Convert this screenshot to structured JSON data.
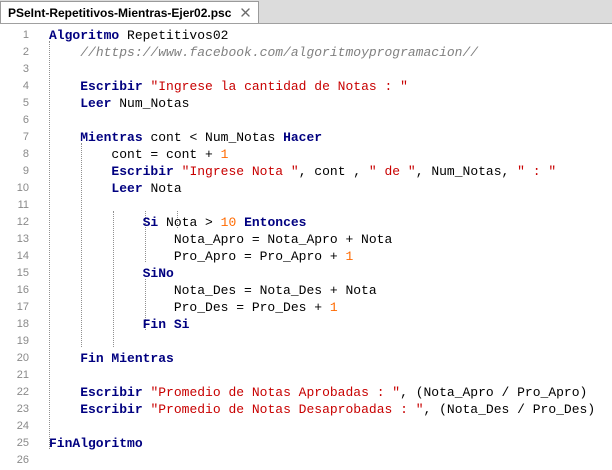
{
  "tab": {
    "title": "PSeInt-Repetitivos-Mientras-Ejer02.psc",
    "close_icon": "close-icon"
  },
  "colors": {
    "keyword": "#000080",
    "string": "#c80000",
    "comment": "#808080",
    "number": "#ff6a00",
    "line_number": "#8a8a8a"
  },
  "lines": [
    {
      "n": "1",
      "tokens": [
        {
          "t": "kw",
          "v": "Algoritmo"
        },
        {
          "t": "txt",
          "v": " Repetitivos02"
        }
      ]
    },
    {
      "n": "2",
      "tokens": [
        {
          "t": "txt",
          "v": "    "
        },
        {
          "t": "cmt",
          "v": "//https://www.facebook.com/algoritmoyprogramacion//"
        }
      ]
    },
    {
      "n": "3",
      "tokens": []
    },
    {
      "n": "4",
      "tokens": [
        {
          "t": "txt",
          "v": "    "
        },
        {
          "t": "kw",
          "v": "Escribir"
        },
        {
          "t": "txt",
          "v": " "
        },
        {
          "t": "str",
          "v": "\"Ingrese la cantidad de Notas : \""
        }
      ]
    },
    {
      "n": "5",
      "tokens": [
        {
          "t": "txt",
          "v": "    "
        },
        {
          "t": "kw",
          "v": "Leer"
        },
        {
          "t": "txt",
          "v": " Num_Notas"
        }
      ]
    },
    {
      "n": "6",
      "tokens": []
    },
    {
      "n": "7",
      "tokens": [
        {
          "t": "txt",
          "v": "    "
        },
        {
          "t": "kw",
          "v": "Mientras"
        },
        {
          "t": "txt",
          "v": " cont < Num_Notas "
        },
        {
          "t": "kw",
          "v": "Hacer"
        }
      ]
    },
    {
      "n": "8",
      "tokens": [
        {
          "t": "txt",
          "v": "        cont = cont + "
        },
        {
          "t": "num",
          "v": "1"
        }
      ]
    },
    {
      "n": "9",
      "tokens": [
        {
          "t": "txt",
          "v": "        "
        },
        {
          "t": "kw",
          "v": "Escribir"
        },
        {
          "t": "txt",
          "v": " "
        },
        {
          "t": "str",
          "v": "\"Ingrese Nota \""
        },
        {
          "t": "txt",
          "v": ", cont , "
        },
        {
          "t": "str",
          "v": "\" de \""
        },
        {
          "t": "txt",
          "v": ", Num_Notas, "
        },
        {
          "t": "str",
          "v": "\" : \""
        }
      ]
    },
    {
      "n": "10",
      "tokens": [
        {
          "t": "txt",
          "v": "        "
        },
        {
          "t": "kw",
          "v": "Leer"
        },
        {
          "t": "txt",
          "v": " Nota"
        }
      ]
    },
    {
      "n": "11",
      "tokens": []
    },
    {
      "n": "12",
      "tokens": [
        {
          "t": "txt",
          "v": "            "
        },
        {
          "t": "kw",
          "v": "Si"
        },
        {
          "t": "txt",
          "v": " Nota > "
        },
        {
          "t": "num",
          "v": "10"
        },
        {
          "t": "txt",
          "v": " "
        },
        {
          "t": "kw",
          "v": "Entonces"
        }
      ]
    },
    {
      "n": "13",
      "tokens": [
        {
          "t": "txt",
          "v": "                Nota_Apro = Nota_Apro + Nota"
        }
      ]
    },
    {
      "n": "14",
      "tokens": [
        {
          "t": "txt",
          "v": "                Pro_Apro = Pro_Apro + "
        },
        {
          "t": "num",
          "v": "1"
        }
      ]
    },
    {
      "n": "15",
      "tokens": [
        {
          "t": "txt",
          "v": "            "
        },
        {
          "t": "kw",
          "v": "SiNo"
        }
      ]
    },
    {
      "n": "16",
      "tokens": [
        {
          "t": "txt",
          "v": "                Nota_Des = Nota_Des + Nota"
        }
      ]
    },
    {
      "n": "17",
      "tokens": [
        {
          "t": "txt",
          "v": "                Pro_Des = Pro_Des + "
        },
        {
          "t": "num",
          "v": "1"
        }
      ]
    },
    {
      "n": "18",
      "tokens": [
        {
          "t": "txt",
          "v": "            "
        },
        {
          "t": "kw",
          "v": "Fin Si"
        }
      ]
    },
    {
      "n": "19",
      "tokens": []
    },
    {
      "n": "20",
      "tokens": [
        {
          "t": "txt",
          "v": "    "
        },
        {
          "t": "kw",
          "v": "Fin Mientras"
        }
      ]
    },
    {
      "n": "21",
      "tokens": []
    },
    {
      "n": "22",
      "tokens": [
        {
          "t": "txt",
          "v": "    "
        },
        {
          "t": "kw",
          "v": "Escribir"
        },
        {
          "t": "txt",
          "v": " "
        },
        {
          "t": "str",
          "v": "\"Promedio de Notas Aprobadas : \""
        },
        {
          "t": "txt",
          "v": ", (Nota_Apro / Pro_Apro)"
        }
      ]
    },
    {
      "n": "23",
      "tokens": [
        {
          "t": "txt",
          "v": "    "
        },
        {
          "t": "kw",
          "v": "Escribir"
        },
        {
          "t": "txt",
          "v": " "
        },
        {
          "t": "str",
          "v": "\"Promedio de Notas Desaprobadas : \""
        },
        {
          "t": "txt",
          "v": ", (Nota_Des / Pro_Des)"
        }
      ]
    },
    {
      "n": "24",
      "tokens": []
    },
    {
      "n": "25",
      "tokens": [
        {
          "t": "kw",
          "v": "FinAlgoritmo"
        }
      ]
    },
    {
      "n": "26",
      "tokens": []
    }
  ]
}
